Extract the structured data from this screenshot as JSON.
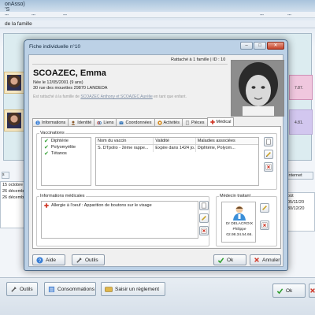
{
  "main_window": {
    "title": "onAsso)",
    "title_suffix": "’S",
    "subbar_label": "de la famille",
    "right_numbers": [
      "7.87.",
      "4.81."
    ],
    "left_tab": "s",
    "right_tab": "Internet",
    "left_list": [
      "15 octobre 2",
      "26 décembr",
      "26 décembr"
    ],
    "right_list_header": "oût",
    "right_list": [
      "05/11/20",
      "30/12/20"
    ],
    "buttons": {
      "outils": "Outils",
      "consommations": "Consommations",
      "saisir": "Saisir un règlement",
      "ok": "Ok"
    }
  },
  "dialog": {
    "title": "Fiche individuelle n°10",
    "attach_text": "Rattaché à 1 famille | ID : 10",
    "name": "SCOAZEC, Emma",
    "birth": "Née le 12/05/2001 (9 ans)",
    "address": "30 rue des mouettes 29870 LANDEDA",
    "note_prefix": "Est rattaché à la famille de",
    "note_link": "SCOAZEC Anthony et SCOAZEC Aurélie",
    "note_suffix": "en tant que enfant.",
    "tabs": [
      {
        "label": "Informations",
        "icon": "info-icon",
        "color": "#3a7fd6"
      },
      {
        "label": "Identité",
        "icon": "identity-icon",
        "color": "#8a5a2a"
      },
      {
        "label": "Liens",
        "icon": "links-icon",
        "color": "#c0392b"
      },
      {
        "label": "Coordonnées",
        "icon": "contact-icon",
        "color": "#2d6fb3"
      },
      {
        "label": "Activités",
        "icon": "activities-icon",
        "color": "#d48a1f"
      },
      {
        "label": "Pièces",
        "icon": "documents-icon",
        "color": "#7a7a7a"
      },
      {
        "label": "Médical",
        "icon": "medical-icon",
        "color": "#d03a2a"
      }
    ],
    "active_tab": "Médical",
    "vaccinations": {
      "label": "Vaccinations",
      "diseases": [
        "Diphtérie",
        "Polyomyélite",
        "Tétanos"
      ],
      "columns": [
        "Nom du vaccin",
        "Validité",
        "Maladies associées"
      ],
      "rows": [
        [
          "S. DTpolio - 2ème rappe...",
          "Expire dans 1424 jo...",
          "Diphtérie, Polyom..."
        ]
      ]
    },
    "medical_info": {
      "label": "Informations médicales",
      "items": [
        "Allergie à l'oeuf : Apparition de boutons sur le visage"
      ]
    },
    "doctor": {
      "label": "Médecin traitant",
      "title": "Dr DELACROIX",
      "first_name": "Philippe",
      "phone": "02.98.34.54.66."
    },
    "buttons": {
      "aide": "Aide",
      "outils": "Outils",
      "ok": "Ok",
      "annuler": "Annuler"
    }
  },
  "colors": {
    "accent": "#3a6ea5",
    "check": "#2f9e2f",
    "close": "#c4432a"
  }
}
